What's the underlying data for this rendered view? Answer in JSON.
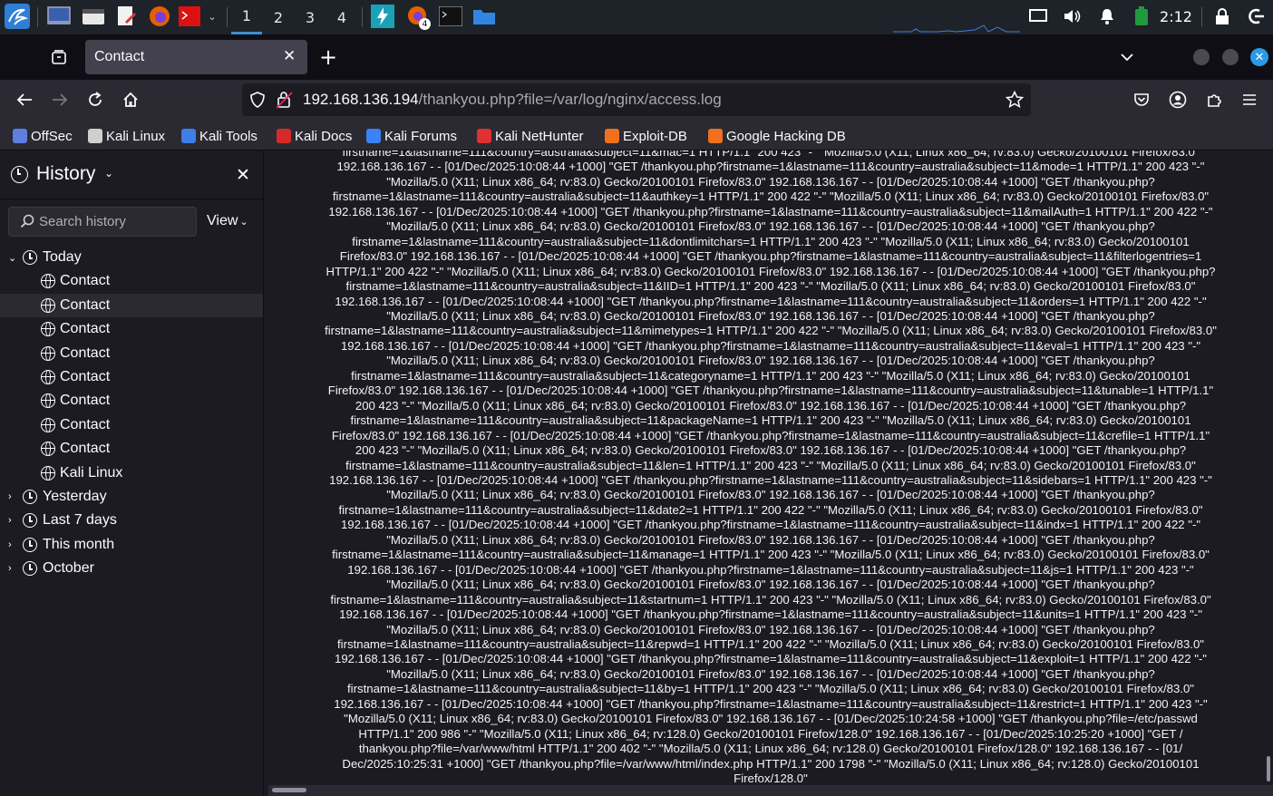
{
  "taskbar": {
    "workspaces": [
      "1",
      "2",
      "3",
      "4"
    ],
    "active_workspace": "1",
    "firefox_badge": "4",
    "clock": "2:12"
  },
  "tabs": [
    {
      "title": "Contact"
    }
  ],
  "navbar": {
    "url_host": "192.168.136.194",
    "url_path": "/thankyou.php?file=/var/log/nginx/access.log"
  },
  "bookmarks": [
    {
      "label": "OffSec",
      "icon": "offsec-icon",
      "color": "#5f7fe0"
    },
    {
      "label": "Kali Linux",
      "icon": "kali-icon",
      "color": "#cfcfcf"
    },
    {
      "label": "Kali Tools",
      "icon": "kali-tools-icon",
      "color": "#3f7ee8"
    },
    {
      "label": "Kali Docs",
      "icon": "kali-docs-icon",
      "color": "#d62a2a"
    },
    {
      "label": "Kali Forums",
      "icon": "kali-forums-icon",
      "color": "#3b82f6"
    },
    {
      "label": "Kali NetHunter",
      "icon": "nethunter-icon",
      "color": "#e03030"
    },
    {
      "label": "Exploit-DB",
      "icon": "exploit-db-icon",
      "color": "#f07020"
    },
    {
      "label": "Google Hacking DB",
      "icon": "ghdb-icon",
      "color": "#f07020"
    }
  ],
  "sidebar": {
    "title": "History",
    "search_placeholder": "Search history",
    "view_label": "View",
    "groups_top": {
      "label": "Today"
    },
    "today_items": [
      "Contact",
      "Contact",
      "Contact",
      "Contact",
      "Contact",
      "Contact",
      "Contact",
      "Contact",
      "Kali Linux"
    ],
    "selected_index": 1,
    "groups_bottom": [
      "Yesterday",
      "Last 7 days",
      "This month",
      "October"
    ]
  },
  "log_lines": [
    "firstname=1&lastname=111&country=australia&subject=11&mac=1 HTTP/1.1\" 200 423 \"-\" \"Mozilla/5.0 (X11; Linux x86_64; rv:83.0) Gecko/20100101 Firefox/83.0\"",
    "192.168.136.167 - - [01/Dec/2025:10:08:44 +1000] \"GET /thankyou.php?firstname=1&lastname=111&country=australia&subject=11&mode=1 HTTP/1.1\" 200 423 \"-\"",
    "\"Mozilla/5.0 (X11; Linux x86_64; rv:83.0) Gecko/20100101 Firefox/83.0\" 192.168.136.167 - - [01/Dec/2025:10:08:44 +1000] \"GET /thankyou.php?",
    "firstname=1&lastname=111&country=australia&subject=11&authkey=1 HTTP/1.1\" 200 422 \"-\" \"Mozilla/5.0 (X11; Linux x86_64; rv:83.0) Gecko/20100101 Firefox/83.0\"",
    "192.168.136.167 - - [01/Dec/2025:10:08:44 +1000] \"GET /thankyou.php?firstname=1&lastname=111&country=australia&subject=11&mailAuth=1 HTTP/1.1\" 200 422 \"-\"",
    "\"Mozilla/5.0 (X11; Linux x86_64; rv:83.0) Gecko/20100101 Firefox/83.0\" 192.168.136.167 - - [01/Dec/2025:10:08:44 +1000] \"GET /thankyou.php?",
    "firstname=1&lastname=111&country=australia&subject=11&dontlimitchars=1 HTTP/1.1\" 200 423 \"-\" \"Mozilla/5.0 (X11; Linux x86_64; rv:83.0) Gecko/20100101",
    "Firefox/83.0\" 192.168.136.167 - - [01/Dec/2025:10:08:44 +1000] \"GET /thankyou.php?firstname=1&lastname=111&country=australia&subject=11&filterlogentries=1",
    "HTTP/1.1\" 200 422 \"-\" \"Mozilla/5.0 (X11; Linux x86_64; rv:83.0) Gecko/20100101 Firefox/83.0\" 192.168.136.167 - - [01/Dec/2025:10:08:44 +1000] \"GET /thankyou.php?",
    "firstname=1&lastname=111&country=australia&subject=11&IID=1 HTTP/1.1\" 200 423 \"-\" \"Mozilla/5.0 (X11; Linux x86_64; rv:83.0) Gecko/20100101 Firefox/83.0\"",
    "192.168.136.167 - - [01/Dec/2025:10:08:44 +1000] \"GET /thankyou.php?firstname=1&lastname=111&country=australia&subject=11&orders=1 HTTP/1.1\" 200 422 \"-\"",
    "\"Mozilla/5.0 (X11; Linux x86_64; rv:83.0) Gecko/20100101 Firefox/83.0\" 192.168.136.167 - - [01/Dec/2025:10:08:44 +1000] \"GET /thankyou.php?",
    "firstname=1&lastname=111&country=australia&subject=11&mimetypes=1 HTTP/1.1\" 200 422 \"-\" \"Mozilla/5.0 (X11; Linux x86_64; rv:83.0) Gecko/20100101 Firefox/83.0\"",
    "192.168.136.167 - - [01/Dec/2025:10:08:44 +1000] \"GET /thankyou.php?firstname=1&lastname=111&country=australia&subject=11&eval=1 HTTP/1.1\" 200 423 \"-\"",
    "\"Mozilla/5.0 (X11; Linux x86_64; rv:83.0) Gecko/20100101 Firefox/83.0\" 192.168.136.167 - - [01/Dec/2025:10:08:44 +1000] \"GET /thankyou.php?",
    "firstname=1&lastname=111&country=australia&subject=11&categoryname=1 HTTP/1.1\" 200 423 \"-\" \"Mozilla/5.0 (X11; Linux x86_64; rv:83.0) Gecko/20100101",
    "Firefox/83.0\" 192.168.136.167 - - [01/Dec/2025:10:08:44 +1000] \"GET /thankyou.php?firstname=1&lastname=111&country=australia&subject=11&tunable=1 HTTP/1.1\"",
    "200 423 \"-\" \"Mozilla/5.0 (X11; Linux x86_64; rv:83.0) Gecko/20100101 Firefox/83.0\" 192.168.136.167 - - [01/Dec/2025:10:08:44 +1000] \"GET /thankyou.php?",
    "firstname=1&lastname=111&country=australia&subject=11&packageName=1 HTTP/1.1\" 200 423 \"-\" \"Mozilla/5.0 (X11; Linux x86_64; rv:83.0) Gecko/20100101",
    "Firefox/83.0\" 192.168.136.167 - - [01/Dec/2025:10:08:44 +1000] \"GET /thankyou.php?firstname=1&lastname=111&country=australia&subject=11&crefile=1 HTTP/1.1\"",
    "200 423 \"-\" \"Mozilla/5.0 (X11; Linux x86_64; rv:83.0) Gecko/20100101 Firefox/83.0\" 192.168.136.167 - - [01/Dec/2025:10:08:44 +1000] \"GET /thankyou.php?",
    "firstname=1&lastname=111&country=australia&subject=11&len=1 HTTP/1.1\" 200 423 \"-\" \"Mozilla/5.0 (X11; Linux x86_64; rv:83.0) Gecko/20100101 Firefox/83.0\"",
    "192.168.136.167 - - [01/Dec/2025:10:08:44 +1000] \"GET /thankyou.php?firstname=1&lastname=111&country=australia&subject=11&sidebars=1 HTTP/1.1\" 200 423 \"-\"",
    "\"Mozilla/5.0 (X11; Linux x86_64; rv:83.0) Gecko/20100101 Firefox/83.0\" 192.168.136.167 - - [01/Dec/2025:10:08:44 +1000] \"GET /thankyou.php?",
    "firstname=1&lastname=111&country=australia&subject=11&date2=1 HTTP/1.1\" 200 422 \"-\" \"Mozilla/5.0 (X11; Linux x86_64; rv:83.0) Gecko/20100101 Firefox/83.0\"",
    "192.168.136.167 - - [01/Dec/2025:10:08:44 +1000] \"GET /thankyou.php?firstname=1&lastname=111&country=australia&subject=11&indx=1 HTTP/1.1\" 200 422 \"-\"",
    "\"Mozilla/5.0 (X11; Linux x86_64; rv:83.0) Gecko/20100101 Firefox/83.0\" 192.168.136.167 - - [01/Dec/2025:10:08:44 +1000] \"GET /thankyou.php?",
    "firstname=1&lastname=111&country=australia&subject=11&manage=1 HTTP/1.1\" 200 423 \"-\" \"Mozilla/5.0 (X11; Linux x86_64; rv:83.0) Gecko/20100101 Firefox/83.0\"",
    "192.168.136.167 - - [01/Dec/2025:10:08:44 +1000] \"GET /thankyou.php?firstname=1&lastname=111&country=australia&subject=11&js=1 HTTP/1.1\" 200 423 \"-\"",
    "\"Mozilla/5.0 (X11; Linux x86_64; rv:83.0) Gecko/20100101 Firefox/83.0\" 192.168.136.167 - - [01/Dec/2025:10:08:44 +1000] \"GET /thankyou.php?",
    "firstname=1&lastname=111&country=australia&subject=11&startnum=1 HTTP/1.1\" 200 423 \"-\" \"Mozilla/5.0 (X11; Linux x86_64; rv:83.0) Gecko/20100101 Firefox/83.0\"",
    "192.168.136.167 - - [01/Dec/2025:10:08:44 +1000] \"GET /thankyou.php?firstname=1&lastname=111&country=australia&subject=11&units=1 HTTP/1.1\" 200 423 \"-\"",
    "\"Mozilla/5.0 (X11; Linux x86_64; rv:83.0) Gecko/20100101 Firefox/83.0\" 192.168.136.167 - - [01/Dec/2025:10:08:44 +1000] \"GET /thankyou.php?",
    "firstname=1&lastname=111&country=australia&subject=11&repwd=1 HTTP/1.1\" 200 422 \"-\" \"Mozilla/5.0 (X11; Linux x86_64; rv:83.0) Gecko/20100101 Firefox/83.0\"",
    "192.168.136.167 - - [01/Dec/2025:10:08:44 +1000] \"GET /thankyou.php?firstname=1&lastname=111&country=australia&subject=11&exploit=1 HTTP/1.1\" 200 422 \"-\"",
    "\"Mozilla/5.0 (X11; Linux x86_64; rv:83.0) Gecko/20100101 Firefox/83.0\" 192.168.136.167 - - [01/Dec/2025:10:08:44 +1000] \"GET /thankyou.php?",
    "firstname=1&lastname=111&country=australia&subject=11&by=1 HTTP/1.1\" 200 423 \"-\" \"Mozilla/5.0 (X11; Linux x86_64; rv:83.0) Gecko/20100101 Firefox/83.0\"",
    "192.168.136.167 - - [01/Dec/2025:10:08:44 +1000] \"GET /thankyou.php?firstname=1&lastname=111&country=australia&subject=11&restrict=1 HTTP/1.1\" 200 423 \"-\"",
    "\"Mozilla/5.0 (X11; Linux x86_64; rv:83.0) Gecko/20100101 Firefox/83.0\" 192.168.136.167 - - [01/Dec/2025:10:24:58 +1000] \"GET /thankyou.php?file=/etc/passwd",
    "HTTP/1.1\" 200 986 \"-\" \"Mozilla/5.0 (X11; Linux x86_64; rv:128.0) Gecko/20100101 Firefox/128.0\" 192.168.136.167 - - [01/Dec/2025:10:25:20 +1000] \"GET /",
    "thankyou.php?file=/var/www/html HTTP/1.1\" 200 402 \"-\" \"Mozilla/5.0 (X11; Linux x86_64; rv:128.0) Gecko/20100101 Firefox/128.0\" 192.168.136.167 - - [01/",
    "Dec/2025:10:25:31 +1000] \"GET /thankyou.php?file=/var/www/html/index.php HTTP/1.1\" 200 1798 \"-\" \"Mozilla/5.0 (X11; Linux x86_64; rv:128.0) Gecko/20100101",
    "Firefox/128.0\""
  ]
}
